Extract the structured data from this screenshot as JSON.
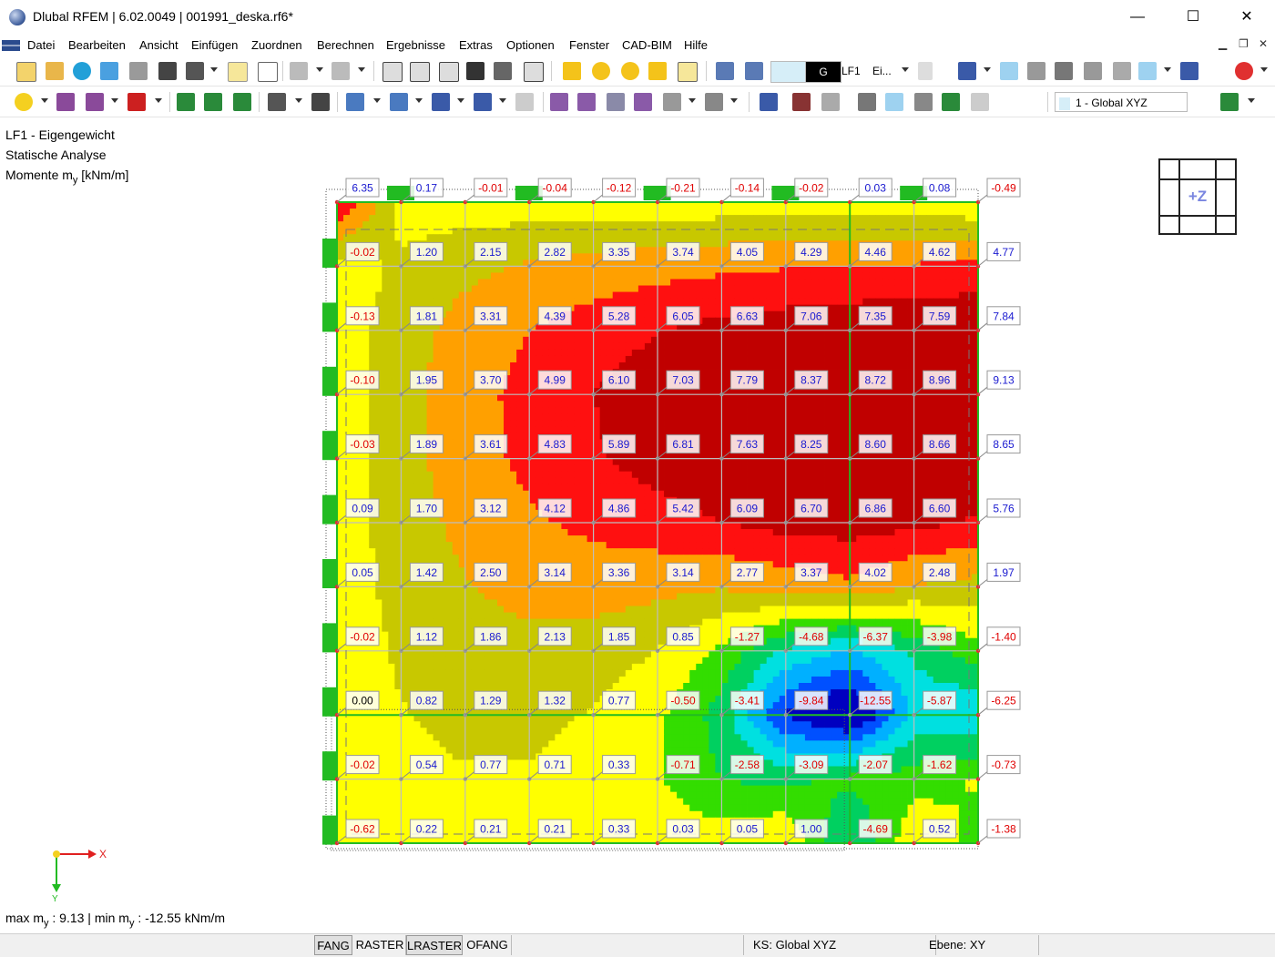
{
  "window": {
    "title": "Dlubal RFEM | 6.02.0049 | 001991_deska.rf6*",
    "minimize_glyph": "—",
    "maximize_glyph": "☐",
    "close_glyph": "✕"
  },
  "menu": {
    "items": [
      "Datei",
      "Bearbeiten",
      "Ansicht",
      "Einfügen",
      "Zuordnen",
      "Berechnen",
      "Ergebnisse",
      "Extras",
      "Optionen",
      "Fenster",
      "CAD-BIM",
      "Hilfe"
    ]
  },
  "toolbar": {
    "load_case_code": "G",
    "load_case": "LF1",
    "load_case_name": "Ei...",
    "coordinate_system": "1 - Global XYZ"
  },
  "view_info": {
    "line1": "LF1 - Eigengewicht",
    "line2": "Statische Analyse",
    "line3_prefix": "Momente m",
    "line3_sub": "y",
    "line3_suffix": " [kNm/m]"
  },
  "view_cube": {
    "label": "+Z"
  },
  "axes": {
    "x": "X",
    "y": "Y"
  },
  "summary": {
    "p1": "max m",
    "s1": "y",
    "p2": " : 9.13 | min m",
    "s2": "y",
    "p3": " : -12.55 kNm/m"
  },
  "statusbar": {
    "buttons": [
      "FANG",
      "RASTER",
      "LRASTER",
      "OFANG"
    ],
    "coord_system": "KS: Global XYZ",
    "plane": "Ebene: XY"
  },
  "result_grid": {
    "rows": [
      [
        "6.35",
        "0.17",
        "-0.01",
        "-0.04",
        "-0.12",
        "-0.21",
        "-0.14",
        "-0.02",
        "0.03",
        "0.08",
        "-0.49"
      ],
      [
        "-0.02",
        "1.20",
        "2.15",
        "2.82",
        "3.35",
        "3.74",
        "4.05",
        "4.29",
        "4.46",
        "4.62",
        "4.77"
      ],
      [
        "-0.13",
        "1.81",
        "3.31",
        "4.39",
        "5.28",
        "6.05",
        "6.63",
        "7.06",
        "7.35",
        "7.59",
        "7.84"
      ],
      [
        "-0.10",
        "1.95",
        "3.70",
        "4.99",
        "6.10",
        "7.03",
        "7.79",
        "8.37",
        "8.72",
        "8.96",
        "9.13"
      ],
      [
        "-0.03",
        "1.89",
        "3.61",
        "4.83",
        "5.89",
        "6.81",
        "7.63",
        "8.25",
        "8.60",
        "8.66",
        "8.65"
      ],
      [
        "0.09",
        "1.70",
        "3.12",
        "4.12",
        "4.86",
        "5.42",
        "6.09",
        "6.70",
        "6.86",
        "6.60",
        "5.76"
      ],
      [
        "0.05",
        "1.42",
        "2.50",
        "3.14",
        "3.36",
        "3.14",
        "2.77",
        "3.37",
        "4.02",
        "2.48",
        "1.97"
      ],
      [
        "-0.02",
        "1.12",
        "1.86",
        "2.13",
        "1.85",
        "0.85",
        "-1.27",
        "-4.68",
        "-6.37",
        "-3.98",
        "-1.40"
      ],
      [
        "0.00",
        "0.82",
        "1.29",
        "1.32",
        "0.77",
        "-0.50",
        "-3.41",
        "-9.84",
        "-12.55",
        "-5.87",
        "-6.25"
      ],
      [
        "-0.02",
        "0.54",
        "0.77",
        "0.71",
        "0.33",
        "-0.71",
        "-2.58",
        "-3.09",
        "-2.07",
        "-1.62",
        "-0.73"
      ],
      [
        "-0.62",
        "0.22",
        "0.21",
        "0.21",
        "0.33",
        "0.03",
        "0.05",
        "1.00",
        "-4.69",
        "0.52",
        "-1.38"
      ]
    ]
  },
  "colors": {
    "pos_label": "#1a1ad0",
    "neg_label": "#e00000",
    "zero_label": "#000000",
    "support": "#22bb22",
    "bands": [
      "#0000c0",
      "#0050ff",
      "#00b0ff",
      "#00e0e0",
      "#00d060",
      "#33dd00",
      "#ffff00",
      "#c8c800",
      "#ffa000",
      "#ff1010",
      "#c00000"
    ]
  }
}
